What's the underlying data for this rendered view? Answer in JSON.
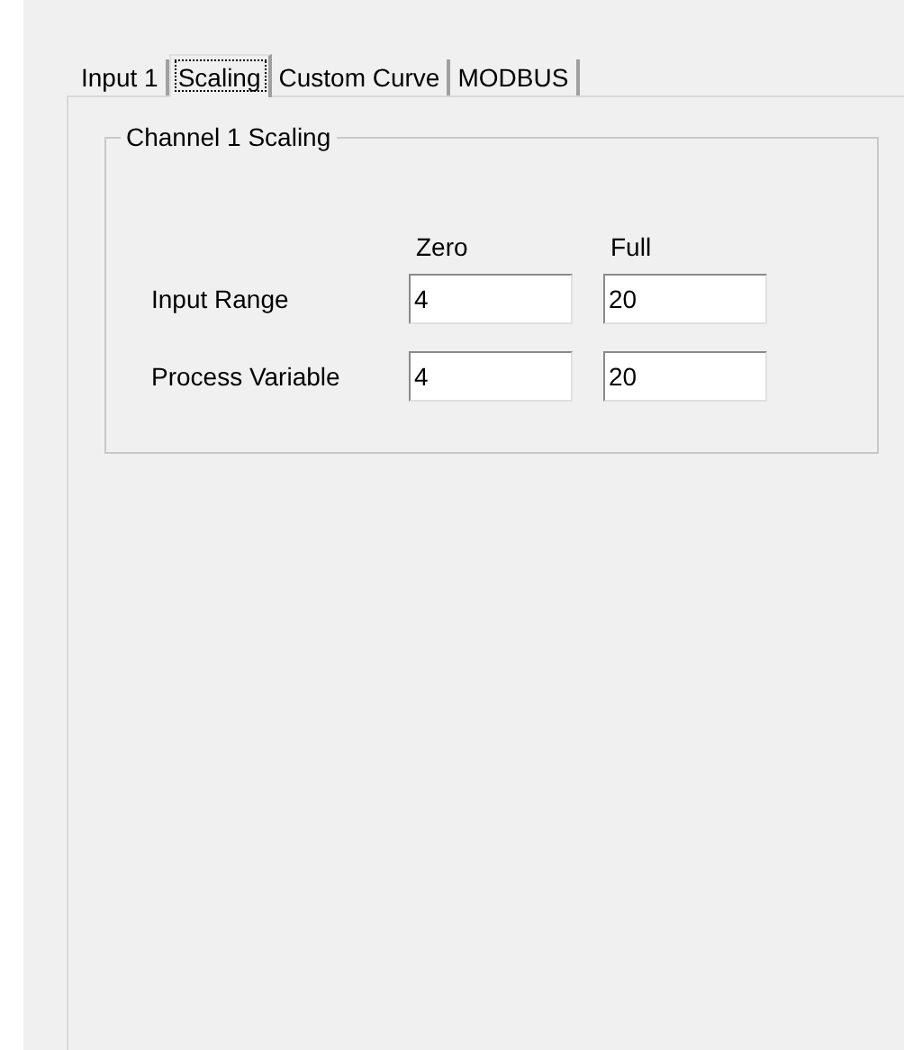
{
  "tabs": [
    {
      "label": "Input 1",
      "selected": false
    },
    {
      "label": "Scaling",
      "selected": true
    },
    {
      "label": "Custom Curve",
      "selected": false
    },
    {
      "label": "MODBUS",
      "selected": false
    }
  ],
  "group": {
    "title": "Channel 1 Scaling",
    "columns": [
      "Zero",
      "Full"
    ],
    "rows": [
      {
        "label": "Input Range",
        "values": [
          "4",
          "20"
        ]
      },
      {
        "label": "Process Variable",
        "values": [
          "4",
          "20"
        ]
      }
    ]
  }
}
